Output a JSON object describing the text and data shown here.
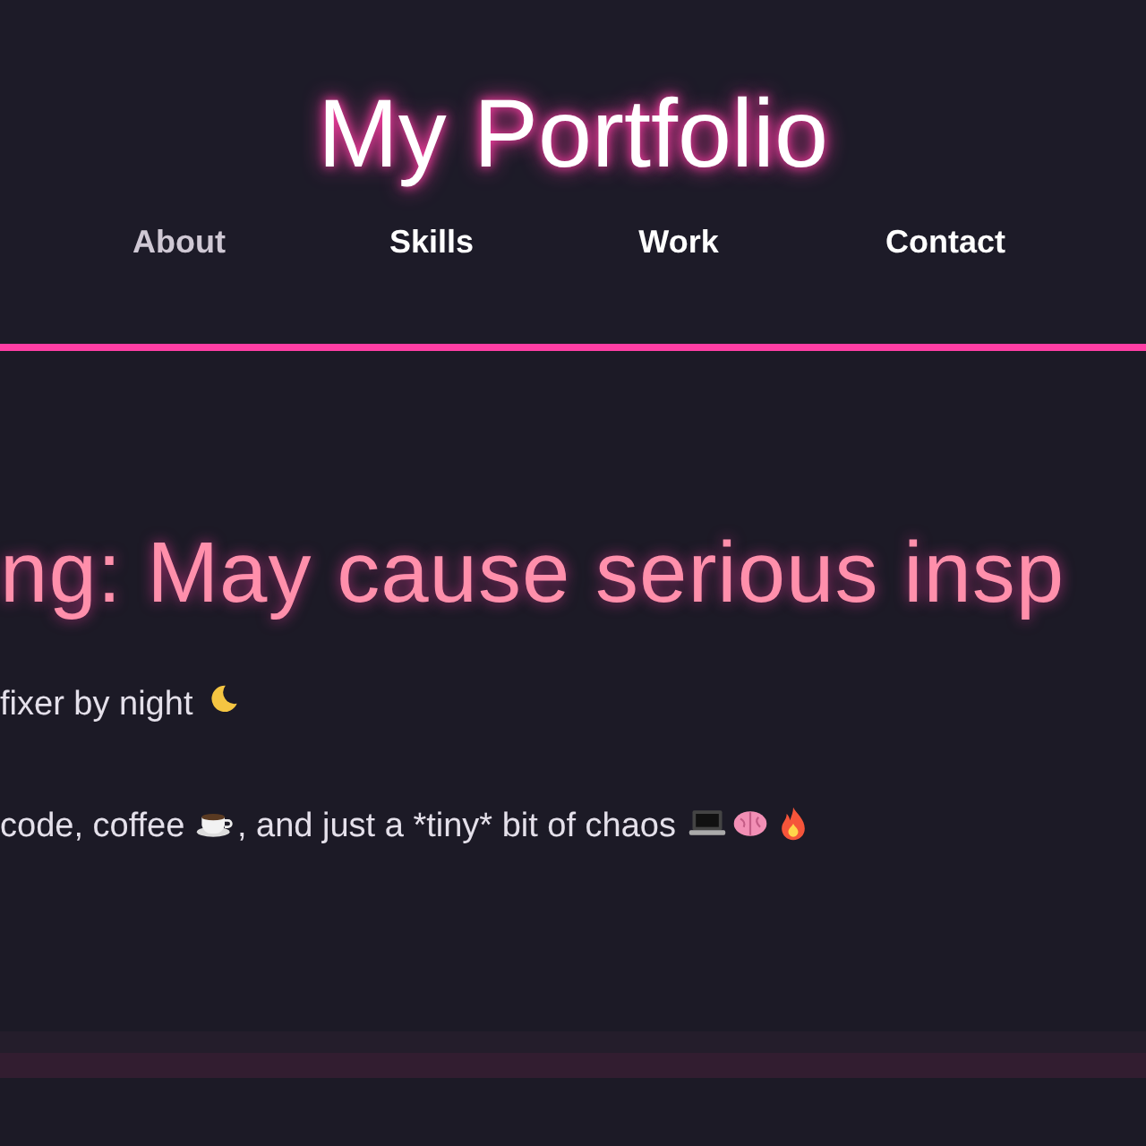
{
  "header": {
    "title": "My Portfolio",
    "nav": [
      {
        "label": "About",
        "selected": true
      },
      {
        "label": "Skills",
        "selected": false
      },
      {
        "label": "Work",
        "selected": false
      },
      {
        "label": "Contact",
        "selected": false
      }
    ]
  },
  "hero": {
    "heading": "ng: May cause serious insp",
    "lines": [
      [
        {
          "kind": "text",
          "text": "fixer by night"
        },
        {
          "kind": "moon"
        }
      ],
      [
        {
          "kind": "text",
          "text": "code, coffee"
        },
        {
          "kind": "coffee"
        },
        {
          "kind": "text",
          "text": ", and just a *tiny* bit of chaos"
        },
        {
          "kind": "laptop"
        },
        {
          "kind": "brain"
        },
        {
          "kind": "fire"
        }
      ]
    ]
  }
}
